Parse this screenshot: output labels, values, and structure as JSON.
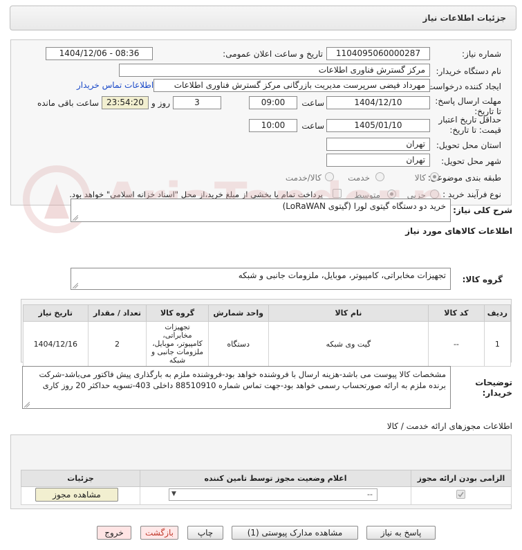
{
  "header": {
    "title": "جزئیات اطلاعات نیاز"
  },
  "form": {
    "need_number_label": "شماره نیاز:",
    "need_number": "1104095060000287",
    "announce_label": "تاریخ و ساعت اعلان عمومی:",
    "announce_value": "1404/12/06 - 08:36",
    "buyer_org_label": "نام دستگاه خریدار:",
    "buyer_org": "مرکز گسترش فناوری اطلاعات",
    "creator_label": "ایجاد کننده درخواست:",
    "creator": "مهرداد فیضی سرپرست مدیریت بازرگانی مرکز گسترش فناوری اطلاعات",
    "contact_link": "اطلاعات تماس خریدار",
    "deadline_label": "مهلت ارسال پاسخ: تا تاریخ:",
    "deadline_date": "1404/12/10",
    "time_label": "ساعت",
    "deadline_time": "09:00",
    "days_value": "3",
    "days_label": "روز و",
    "remaining_time": "23:54:20",
    "remaining_label": "ساعت باقی مانده",
    "validity_label": "حداقل تاریخ اعتبار قیمت: تا تاریخ:",
    "validity_date": "1405/01/10",
    "validity_time": "10:00",
    "province_label": "استان محل تحویل:",
    "province": "تهران",
    "city_label": "شهر محل تحویل:",
    "city": "تهران",
    "category_label": "طبقه بندی موضوعی:",
    "category_options": [
      "کالا",
      "خدمت",
      "کالا/خدمت"
    ],
    "purchase_type_label": "نوع فرآیند خرید :",
    "purchase_options": [
      "جزیی",
      "متوسط"
    ],
    "purchase_note": "پرداخت تمام یا بخشی از مبلغ خرید،از محل \"اسناد خزانه اسلامی\" خواهد بود."
  },
  "description": {
    "label": "شرح کلی نیاز:",
    "value": "خرید دو دستگاه گیتوی لورا (گیتوی LoRaWAN)"
  },
  "goods": {
    "section_title": "اطلاعات کالاهای مورد نیاز",
    "group_label": "گروه کالا:",
    "group_value": "تجهیزات مخابراتی، کامپیوتر، موبایل، ملزومات جانبی و شبکه",
    "columns": [
      "ردیف",
      "کد کالا",
      "نام کالا",
      "واحد شمارش",
      "گروه کالا",
      "تعداد / مقدار",
      "تاریخ نیاز"
    ],
    "rows": [
      {
        "row": "1",
        "code": "--",
        "name": "گیت وی شبکه",
        "unit": "دستگاه",
        "group": "تجهیزات مخابراتی، کامپیوتر، موبایل، ملزومات جانبی و شبکه",
        "qty": "2",
        "date": "1404/12/16"
      }
    ]
  },
  "buyer_notes": {
    "label": "توضیحات خریدار:",
    "line1": "مشخصات کالا پیوست می باشد-هزینه ارسال با فروشنده خواهد بود-فروشنده ملزم به بارگذاری پیش فاکتور می‌باشد-شرکت",
    "line2": "برنده ملزم به ارائه صورتحساب رسمی خواهد بود-جهت تماس شماره 88510910 داخلی 403-تسویه حداکثر 20 روز کاری"
  },
  "permits": {
    "title": "اطلاعات مجوزهای ارائه خدمت / کالا",
    "columns": [
      "الزامی بودن ارائه مجوز",
      "اعلام وضعیت مجوز توسط تامین کننده",
      "جزئیات"
    ],
    "select_value": "--",
    "view_button": "مشاهده مجوز"
  },
  "footer": {
    "reply": "پاسخ به نیاز",
    "view_docs": "مشاهده مدارک پیوستی (1)",
    "print": "چاپ",
    "back": "بازگشت",
    "exit": "خروج"
  },
  "watermark": {
    "text": "AriaTender.neT"
  }
}
